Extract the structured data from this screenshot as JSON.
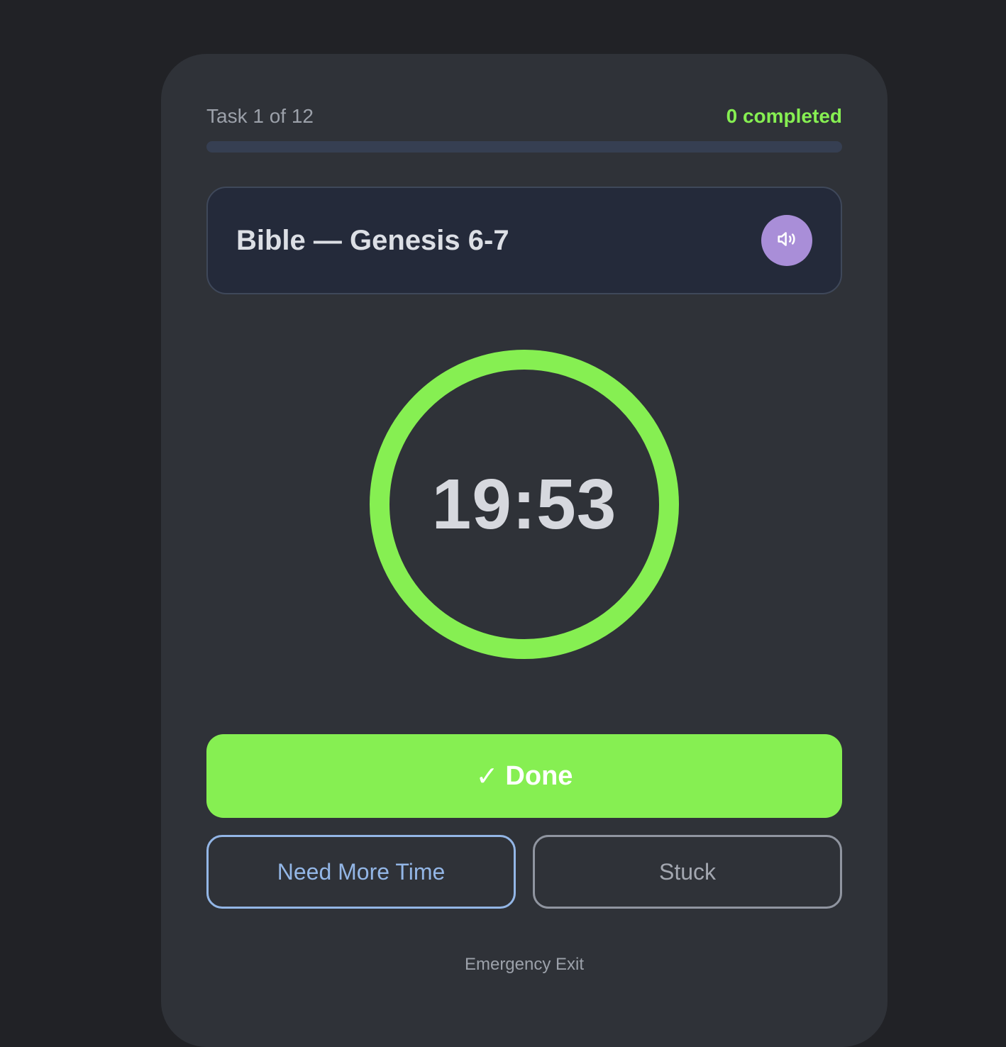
{
  "header": {
    "task_count": "Task 1 of 12",
    "completed": "0 completed",
    "progress_fraction": 0
  },
  "task": {
    "title": "Bible — Genesis 6-7",
    "audio_icon": "speaker-icon"
  },
  "timer": {
    "time": "19:53",
    "ring_fraction": 1.0,
    "ring_color": "#86ef52"
  },
  "actions": {
    "done_check": "✓",
    "done_label": "Done",
    "more_time_label": "Need More Time",
    "stuck_label": "Stuck",
    "emergency_exit_label": "Emergency Exit"
  },
  "colors": {
    "accent": "#86ef52",
    "background": "#212226",
    "card": "#2f3238",
    "audio_button": "#a98ed8",
    "more_time": "#93b6e6"
  }
}
